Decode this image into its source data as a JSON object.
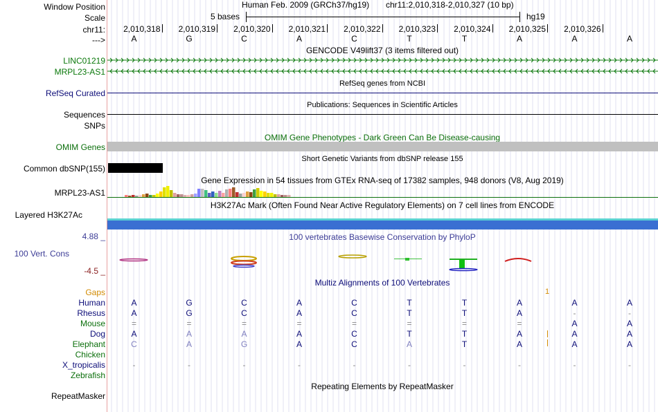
{
  "left_labels": {
    "window_position": "Window Position",
    "scale": "Scale",
    "chrom": "chr11:",
    "arrow": "--->",
    "linc": "LINC01219",
    "mrpl": "MRPL23-AS1",
    "refseq": "RefSeq Curated",
    "sequences": "Sequences",
    "snps": "SNPs",
    "omim": "OMIM Genes",
    "dbsnp": "Common dbSNP(155)",
    "gtex": "MRPL23-AS1",
    "h3k27ac": "Layered H3K27Ac",
    "cons_max": "4.88 _",
    "cons_label": "100 Vert. Cons",
    "cons_min": "-4.5 _",
    "gaps": "Gaps",
    "species": [
      "Human",
      "Rhesus",
      "Mouse",
      "Dog",
      "Elephant",
      "Chicken",
      "X_tropicalis",
      "Zebrafish"
    ],
    "repeatmasker": "RepeatMasker"
  },
  "header": {
    "assembly": "Human Feb. 2009 (GRCh37/hg19)",
    "position": "chr11:2,010,318-2,010,327 (10 bp)",
    "scale_text": "5 bases",
    "db": "hg19"
  },
  "coords": [
    "2,010,318",
    "2,010,319",
    "2,010,320",
    "2,010,321",
    "2,010,322",
    "2,010,323",
    "2,010,324",
    "2,010,325",
    "2,010,326"
  ],
  "bases": [
    "A",
    "G",
    "C",
    "A",
    "C",
    "T",
    "T",
    "A",
    "A",
    "A"
  ],
  "track_titles": {
    "gencode": "GENCODE V49lift37 (3 items filtered out)",
    "refseq": "RefSeq genes from NCBI",
    "publications": "Publications: Sequences in Scientific Articles",
    "omim": "OMIM Gene Phenotypes - Dark Green Can Be Disease-causing",
    "dbsnp": "Short Genetic Variants from dbSNP release 155",
    "gtex": "Gene Expression in 54 tissues from GTEx RNA-seq of 17382 samples, 948 donors (V8, Aug 2019)",
    "h3k27ac": "H3K27Ac Mark (Often Found Near Active Regulatory Elements) on 7 cell lines from ENCODE",
    "phylop": "100 vertebrates Basewise Conservation by PhyloP",
    "multiz": "Multiz Alignments of 100 Vertebrates",
    "repeatmasker": "Repeating Elements by RepeatMasker"
  },
  "gaps_mark": "1",
  "alignment": {
    "Human": [
      "A",
      "G",
      "C",
      "A",
      "C",
      "T",
      "T",
      "A",
      "A",
      "A"
    ],
    "Rhesus": [
      "A",
      "G",
      "C",
      "A",
      "C",
      "T",
      "T",
      "A",
      "-",
      "-"
    ],
    "Mouse": [
      "=",
      "=",
      "=",
      "=",
      "=",
      "=",
      "=",
      "=",
      "A",
      "A"
    ],
    "Dog": [
      "A",
      "A",
      "A",
      "A",
      "C",
      "T",
      "T",
      "A",
      "A",
      "A"
    ],
    "Elephant": [
      "C",
      "A",
      "G",
      "A",
      "C",
      "A",
      "T",
      "A",
      "A",
      "A"
    ],
    "Chicken": [
      "",
      "",
      "",
      "",
      "",
      "",
      "",
      "",
      "",
      ""
    ],
    "X_tropicalis": [
      "-",
      "-",
      "-",
      "-",
      "-",
      "-",
      "-",
      "-",
      "-",
      "-"
    ],
    "Zebrafish": [
      "",
      "",
      "",
      "",
      "",
      "",
      "",
      "",
      "",
      ""
    ]
  },
  "colors": {
    "linc": "#0a780a",
    "refseq": "#0c0c78",
    "omim": "#0a6e0a",
    "cons": "#3c3c96",
    "cons_min": "#8b2020",
    "gaps": "#d28a00",
    "species": "#0c0c78",
    "species_alt": "#0a6e0a",
    "h3k27ac_blue": "#3a6fd2",
    "h3k27ac_cyan": "#5bd2d2"
  }
}
